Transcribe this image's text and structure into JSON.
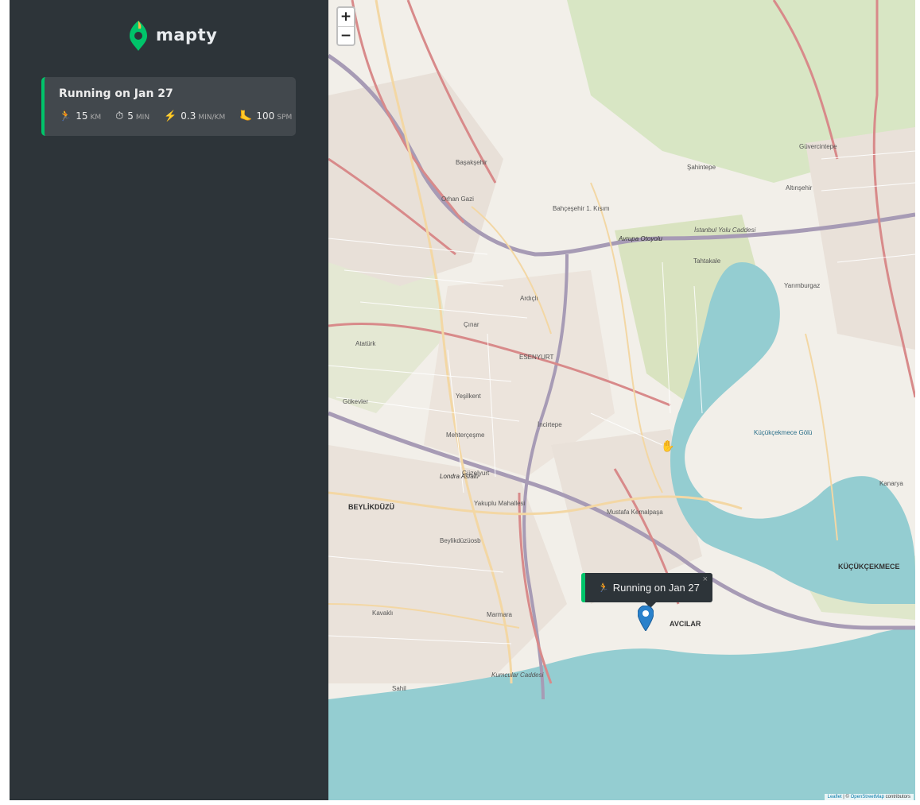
{
  "app": {
    "name": "mapty"
  },
  "colors": {
    "sidebar": "#2d3439",
    "card": "#42484d",
    "running_accent": "#00c46a",
    "marker": "#2a81cb",
    "water": "#94cdd1"
  },
  "workouts": [
    {
      "title": "Running on Jan 27",
      "type": "running",
      "details": [
        {
          "icon": "🏃",
          "icon_name": "runner-icon",
          "value": "15",
          "unit": "km"
        },
        {
          "icon": "⏱",
          "icon_name": "stopwatch-icon",
          "value": "5",
          "unit": "min"
        },
        {
          "icon": "⚡",
          "icon_name": "lightning-icon",
          "value": "0.3",
          "unit": "min/km"
        },
        {
          "icon": "🦶",
          "icon_name": "footprint-icon",
          "value": "100",
          "unit": "spm"
        }
      ]
    }
  ],
  "map": {
    "zoom_in": "+",
    "zoom_out": "−",
    "popup": {
      "icon": "🏃",
      "text": "Running on Jan 27",
      "close": "×"
    },
    "attribution": {
      "leaflet": "Leaflet",
      "sep": " | © ",
      "osm": "OpenStreetMap",
      "tail": " contributors"
    },
    "labels": {
      "esenyurt": "ESENYURT",
      "beylikduzu": "BEYLİKDÜZÜ",
      "avcilar": "AVCILAR",
      "kucukcekmece": "KÜÇÜKÇEKMECE",
      "kucukcekmece_golu": "Küçükçekmece Gölü",
      "avrupa_otoyolu": "Avrupa Otoyolu",
      "londra_asfalti": "Londra Asfaltı",
      "basaksehir": "Başakşehir",
      "sahintepe": "Şahintepe",
      "guvercintepe": "Güvercintepe",
      "altinsehir": "Altınşehir",
      "bahcesehir": "Bahçeşehir 1. Kısım",
      "orhan_gazi": "Orhan Gazi",
      "ardicli": "Ardıçlı",
      "cinar": "Çınar",
      "ataturk": "Atatürk",
      "gokevler": "Gökevler",
      "yesilkent": "Yeşilkent",
      "mehtercesme": "Mehterçeşme",
      "incirtepe": "İncirtepe",
      "guzelyurt": "Güzelyurt",
      "yakuplu": "Yakuplu Mahallesi",
      "mustafa_kemalpasa": "Mustafa Kemalpaşa",
      "beylikduzu_osb": "Beylikdüzüosb",
      "kavakli": "Kavaklı",
      "marmara": "Marmara",
      "sahil": "Sahil",
      "tahtakale": "Tahtakale",
      "yarimburgaz": "Yarımburgaz",
      "kanarya": "Kanarya",
      "kumcular": "Kumcular Caddesi",
      "istanbul_yolu": "İstanbul Yolu Caddesi"
    }
  }
}
